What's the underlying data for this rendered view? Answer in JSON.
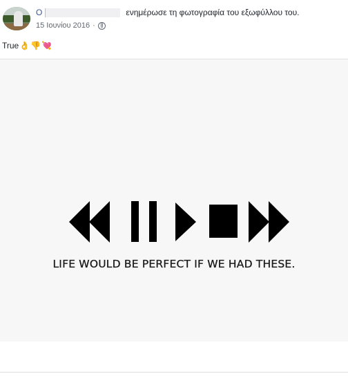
{
  "post": {
    "author_initial": "Ο",
    "action": "ενημέρωσε τη φωτογραφία του εξωφύλλου του.",
    "date": "15 Ιουνίου 2016",
    "separator": "·",
    "privacy_icon": "globe-icon",
    "caption": "True",
    "caption_emojis": [
      "👌",
      "👎",
      "💘"
    ]
  },
  "cover_image": {
    "tagline": "LIFE WOULD BE PERFECT IF WE HAD THESE.",
    "icons": [
      "rewind-icon",
      "pause-icon",
      "play-icon",
      "stop-icon",
      "fast-forward-icon"
    ]
  },
  "colors": {
    "link": "#365899",
    "text": "#1d2129",
    "meta": "#616770",
    "divider": "#dddfe2",
    "icon": "#000000"
  }
}
